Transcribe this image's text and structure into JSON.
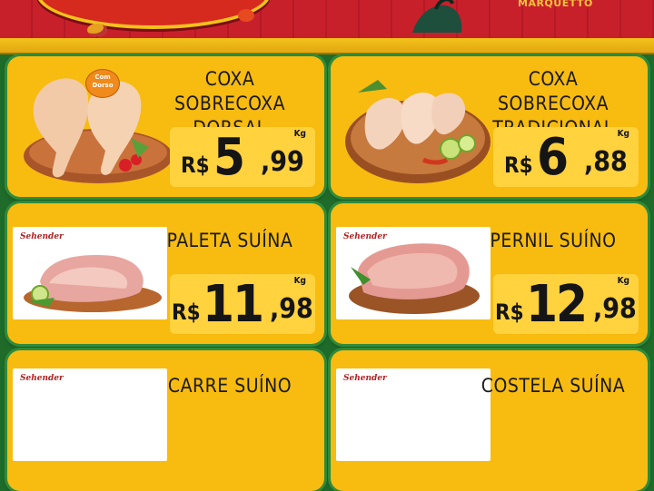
{
  "header": {
    "brand": "MARQUETTO"
  },
  "products": [
    {
      "name_lines": [
        "COXA SOBRECOXA",
        "DORSAL"
      ],
      "badge": "Com Dorso",
      "currency": "R$",
      "price_int": "5",
      "price_dec": ",99",
      "unit": "Kg"
    },
    {
      "name_lines": [
        "COXA SOBRECOXA",
        "TRADICIONAL"
      ],
      "currency": "R$",
      "price_int": "6",
      "price_dec": ",88",
      "unit": "Kg"
    },
    {
      "name_lines": [
        "PALETA SUÍNA"
      ],
      "brand": "Sehender",
      "currency": "R$",
      "price_int": "11",
      "price_dec": ",98",
      "unit": "Kg"
    },
    {
      "name_lines": [
        "PERNIL SUÍNO"
      ],
      "brand": "Sehender",
      "currency": "R$",
      "price_int": "12",
      "price_dec": ",98",
      "unit": "Kg"
    },
    {
      "name_lines": [
        "CARRE SUÍNO"
      ],
      "brand": "Sehender"
    },
    {
      "name_lines": [
        "COSTELA SUÍNA"
      ],
      "brand": "Sehender"
    }
  ],
  "colors": {
    "background": "#1f6b2a",
    "card": "#f8bb10",
    "banner_red": "#c8202b",
    "price_box": "#ffd23e"
  }
}
